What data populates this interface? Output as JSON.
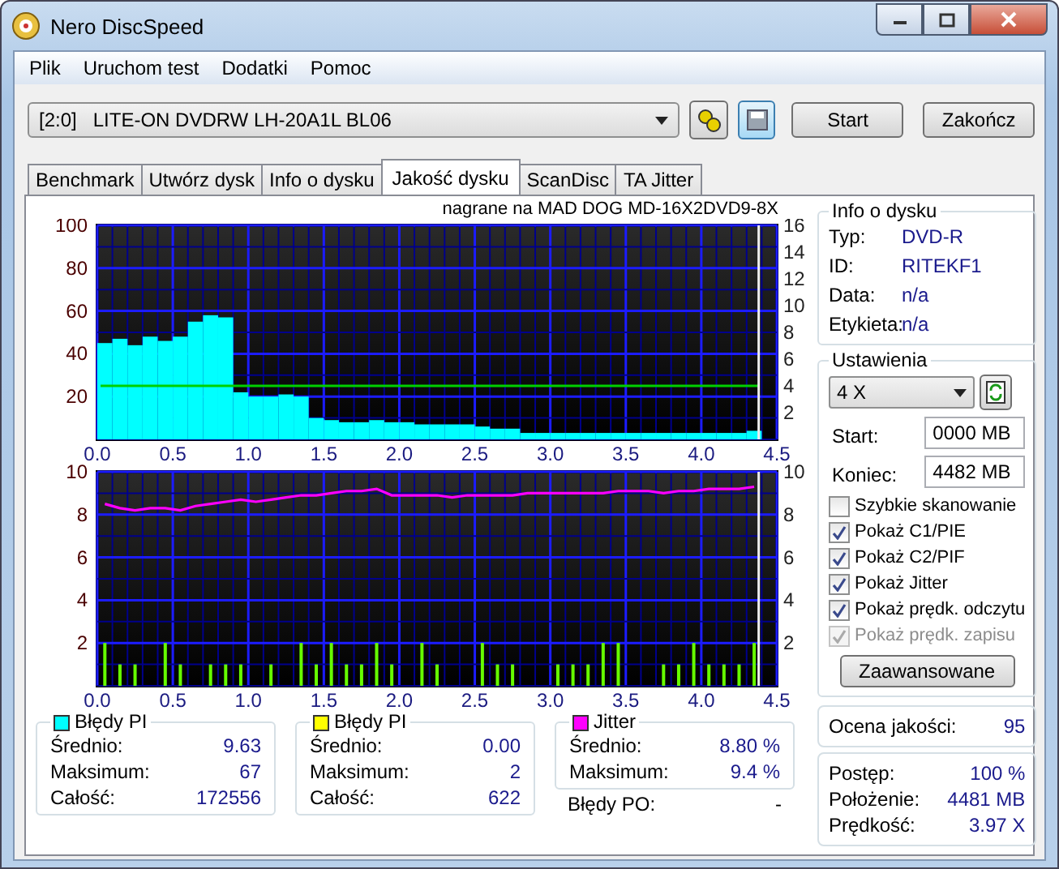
{
  "window": {
    "title": "Nero DiscSpeed"
  },
  "menu": [
    "Plik",
    "Uruchom test",
    "Dodatki",
    "Pomoc"
  ],
  "toolbar": {
    "drive": "[2:0]   LITE-ON DVDRW LH-20A1L BL06",
    "buttons": [
      "Start",
      "Zakończ"
    ]
  },
  "tabs": [
    {
      "label": "Benchmark",
      "selected": false
    },
    {
      "label": "Utwórz dysk",
      "selected": false
    },
    {
      "label": "Info o dysku",
      "selected": false
    },
    {
      "label": "Jakość dysku",
      "selected": true
    },
    {
      "label": "ScanDisc",
      "selected": false
    },
    {
      "label": "TA Jitter",
      "selected": false
    }
  ],
  "charts": [
    {
      "chart_data": {
        "type": "bar",
        "title": "nagrane na MAD DOG  MD-16X2DVD9-8X",
        "grid": true,
        "x": [
          0.05,
          0.15,
          0.25,
          0.35,
          0.45,
          0.55,
          0.65,
          0.75,
          0.85,
          0.95,
          1.05,
          1.15,
          1.25,
          1.35,
          1.45,
          1.55,
          1.65,
          1.75,
          1.85,
          1.95,
          2.05,
          2.15,
          2.25,
          2.35,
          2.45,
          2.55,
          2.65,
          2.75,
          2.85,
          2.95,
          3.05,
          3.15,
          3.25,
          3.35,
          3.45,
          3.55,
          3.65,
          3.75,
          3.85,
          3.95,
          4.05,
          4.15,
          4.25,
          4.35
        ],
        "xlim": [
          0,
          4.5
        ],
        "ylim": [
          0,
          100
        ],
        "y2lim": [
          0,
          16
        ],
        "xticks": [
          {
            "value": 0,
            "label": "0.0"
          },
          {
            "value": 0.5,
            "label": "0.5"
          },
          {
            "value": 1,
            "label": "1.0"
          },
          {
            "value": 1.5,
            "label": "1.5"
          },
          {
            "value": 2,
            "label": "2.0"
          },
          {
            "value": 2.5,
            "label": "2.5"
          },
          {
            "value": 3,
            "label": "3.0"
          },
          {
            "value": 3.5,
            "label": "3.5"
          },
          {
            "value": 4,
            "label": "4.0"
          },
          {
            "value": 4.5,
            "label": "4.5"
          }
        ],
        "yticks": [
          20,
          40,
          60,
          80,
          100
        ],
        "y2ticks": [
          2,
          4,
          6,
          8,
          10,
          12,
          14,
          16
        ],
        "series": [
          {
            "color": "#00ffff",
            "values": [
              45,
              47,
              44,
              48,
              46,
              48,
              55,
              58,
              57,
              22,
              20,
              20,
              21,
              20,
              10,
              9,
              8,
              8,
              9,
              8,
              8,
              7,
              7,
              7,
              7,
              6,
              5,
              5,
              3,
              3,
              3,
              3,
              3,
              3,
              3,
              3,
              3,
              3,
              3,
              3,
              3,
              3,
              3,
              4
            ]
          }
        ],
        "ref_lines": [
          {
            "axis": "y2",
            "value": 4,
            "color": "#00d000"
          },
          {
            "axis": "x",
            "value": 4.38,
            "color": "#eeeeee"
          }
        ]
      }
    },
    {
      "chart_data": {
        "type": "line",
        "grid": true,
        "x": [
          0.05,
          0.15,
          0.25,
          0.35,
          0.45,
          0.55,
          0.65,
          0.75,
          0.85,
          0.95,
          1.05,
          1.15,
          1.25,
          1.35,
          1.45,
          1.55,
          1.65,
          1.75,
          1.85,
          1.95,
          2.05,
          2.15,
          2.25,
          2.35,
          2.45,
          2.55,
          2.65,
          2.75,
          2.85,
          2.95,
          3.05,
          3.15,
          3.25,
          3.35,
          3.45,
          3.55,
          3.65,
          3.75,
          3.85,
          3.95,
          4.05,
          4.15,
          4.25,
          4.35
        ],
        "xlim": [
          0,
          4.5
        ],
        "ylim": [
          0,
          10
        ],
        "y2lim": [
          0,
          10
        ],
        "xticks": [
          {
            "value": 0,
            "label": "0.0"
          },
          {
            "value": 0.5,
            "label": "0.5"
          },
          {
            "value": 1,
            "label": "1.0"
          },
          {
            "value": 1.5,
            "label": "1.5"
          },
          {
            "value": 2,
            "label": "2.0"
          },
          {
            "value": 2.5,
            "label": "2.5"
          },
          {
            "value": 3,
            "label": "3.0"
          },
          {
            "value": 3.5,
            "label": "3.5"
          },
          {
            "value": 4,
            "label": "4.0"
          },
          {
            "value": 4.5,
            "label": "4.5"
          }
        ],
        "yticks": [
          2,
          4,
          6,
          8,
          10
        ],
        "y2ticks": [
          2,
          4,
          6,
          8,
          10
        ],
        "series": [
          {
            "type": "line",
            "color": "#ff00ff",
            "values": [
              8.5,
              8.3,
              8.2,
              8.3,
              8.3,
              8.2,
              8.4,
              8.5,
              8.6,
              8.7,
              8.6,
              8.7,
              8.8,
              8.9,
              8.9,
              9.0,
              9.1,
              9.1,
              9.2,
              8.9,
              8.9,
              8.9,
              8.9,
              8.8,
              8.9,
              8.9,
              8.9,
              8.9,
              9.0,
              9.0,
              9.0,
              9.0,
              9.0,
              9.0,
              9.1,
              9.1,
              9.1,
              9.0,
              9.1,
              9.1,
              9.2,
              9.2,
              9.2,
              9.3
            ]
          },
          {
            "type": "bar",
            "color": "#66ff00",
            "values": [
              2,
              1,
              1,
              0,
              2,
              1,
              0,
              1,
              1,
              1,
              0,
              1,
              0,
              2,
              1,
              2,
              1,
              1,
              2,
              1,
              0,
              2,
              1,
              0,
              0,
              2,
              1,
              1,
              0,
              0,
              1,
              1,
              1,
              2,
              2,
              0,
              0,
              1,
              1,
              2,
              1,
              1,
              1,
              2
            ]
          }
        ],
        "ref_lines": [
          {
            "axis": "x",
            "value": 4.38,
            "color": "#eeeeee"
          }
        ]
      }
    }
  ],
  "stats": [
    {
      "title": "Błędy PI",
      "color": "#00ffff",
      "rows": [
        {
          "label": "Średnio:",
          "value": "9.63"
        },
        {
          "label": "Maksimum:",
          "value": "67"
        },
        {
          "label": "Całość:",
          "value": "172556"
        }
      ]
    },
    {
      "title": "Błędy PI",
      "color": "#ffff00",
      "rows": [
        {
          "label": "Średnio:",
          "value": "0.00"
        },
        {
          "label": "Maksimum:",
          "value": "2"
        },
        {
          "label": "Całość:",
          "value": "622"
        }
      ]
    },
    {
      "title": "Jitter",
      "color": "#ff00ff",
      "rows": [
        {
          "label": "Średnio:",
          "value": "8.80 %"
        },
        {
          "label": "Maksimum:",
          "value": "9.4 %"
        }
      ],
      "extra": {
        "label": "Błędy PO:",
        "value": "-"
      }
    }
  ],
  "disc_info": {
    "title": "Info o dysku",
    "rows": [
      {
        "label": "Typ:",
        "value": "DVD-R"
      },
      {
        "label": "ID:",
        "value": "RITEKF1"
      },
      {
        "label": "Data:",
        "value": "n/a"
      },
      {
        "label": "Etykieta:",
        "value": "n/a"
      }
    ]
  },
  "settings": {
    "title": "Ustawienia",
    "speed": "4 X",
    "fields": [
      {
        "label": "Start:",
        "value": "0000 MB"
      },
      {
        "label": "Koniec:",
        "value": "4482 MB"
      }
    ],
    "checkboxes": [
      {
        "label": "Szybkie skanowanie",
        "checked": false,
        "disabled": false
      },
      {
        "label": "Pokaż C1/PIE",
        "checked": true,
        "disabled": false
      },
      {
        "label": "Pokaż C2/PIF",
        "checked": true,
        "disabled": false
      },
      {
        "label": "Pokaż Jitter",
        "checked": true,
        "disabled": false
      },
      {
        "label": "Pokaż prędk. odczytu",
        "checked": true,
        "disabled": false
      },
      {
        "label": "Pokaż prędk. zapisu",
        "checked": true,
        "disabled": true
      }
    ],
    "button": "Zaawansowane"
  },
  "quality": {
    "label": "Ocena jakości:",
    "value": "95"
  },
  "progress": [
    {
      "label": "Postęp:",
      "value": "100 %"
    },
    {
      "label": "Położenie:",
      "value": "4481 MB"
    },
    {
      "label": "Prędkość:",
      "value": "3.97 X"
    }
  ]
}
